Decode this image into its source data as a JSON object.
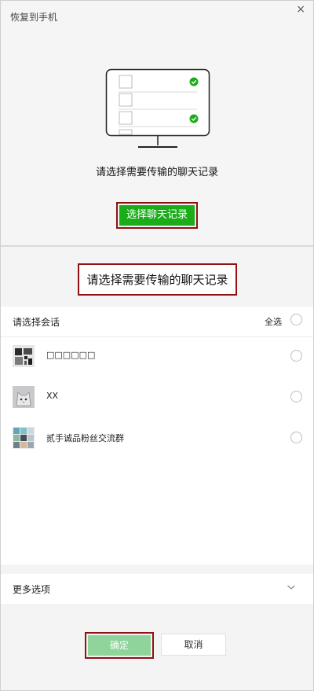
{
  "window": {
    "title": "恢复到手机",
    "close_glyph": "×"
  },
  "top": {
    "prompt": "请选择需要传输的聊天记录",
    "select_button": "选择聊天记录",
    "illustration": "monitor-icon",
    "check_color": "#1aad19"
  },
  "bottom": {
    "heading": "请选择需要传输的聊天记录",
    "list_header": {
      "label": "请选择会话",
      "select_all": "全选"
    },
    "conversations": [
      {
        "name": "□□□□□□",
        "avatar": "qr-avatar"
      },
      {
        "name": "XX",
        "avatar": "cat-avatar"
      },
      {
        "name": "贰手诚品粉丝交流群",
        "avatar": "group-avatar"
      }
    ],
    "more_options": "更多选项",
    "confirm": "确定",
    "cancel": "取消"
  },
  "colors": {
    "accent": "#1aad19",
    "highlight": "#8e1212",
    "confirm_disabled": "#8fd49a"
  }
}
